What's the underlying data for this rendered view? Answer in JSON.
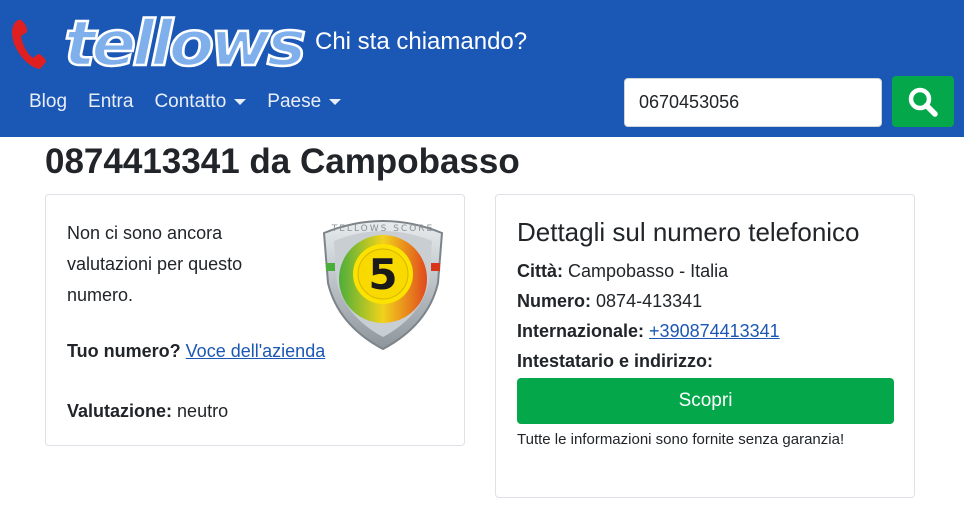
{
  "header": {
    "logo_text": "tellows",
    "tagline": "Chi sta chiamando?",
    "nav": [
      {
        "label": "Blog",
        "dropdown": false
      },
      {
        "label": "Entra",
        "dropdown": false
      },
      {
        "label": "Contatto",
        "dropdown": true
      },
      {
        "label": "Paese",
        "dropdown": true
      }
    ],
    "search": {
      "value": "0670453056",
      "icon": "search-icon"
    },
    "colors": {
      "navbar": "#1b57b4",
      "search_button": "#04a84a"
    }
  },
  "page": {
    "title": "0874413341 da Campobasso"
  },
  "rating_card": {
    "no_ratings_text": "Non ci sono ancora valutazioni per questo numero.",
    "owner_label": "Tuo numero?",
    "owner_link": "Voce dell'azienda",
    "rating_label": "Valutazione:",
    "rating_value": "neutro",
    "score_badge": {
      "label": "TELLOWS SCORE",
      "score": "5"
    }
  },
  "details_card": {
    "title": "Dettagli sul numero telefonico",
    "city_label": "Città:",
    "city_value": "Campobasso - Italia",
    "number_label": "Numero:",
    "number_value": "0874-413341",
    "international_label": "Internazionale:",
    "international_value": "+390874413341",
    "owner_address_label": "Intestatario e indirizzo:",
    "discover_button": "Scopri",
    "disclaimer": "Tutte le informazioni sono fornite senza garanzia!",
    "colors": {
      "button": "#04a84a",
      "link": "#1b57b4"
    }
  }
}
